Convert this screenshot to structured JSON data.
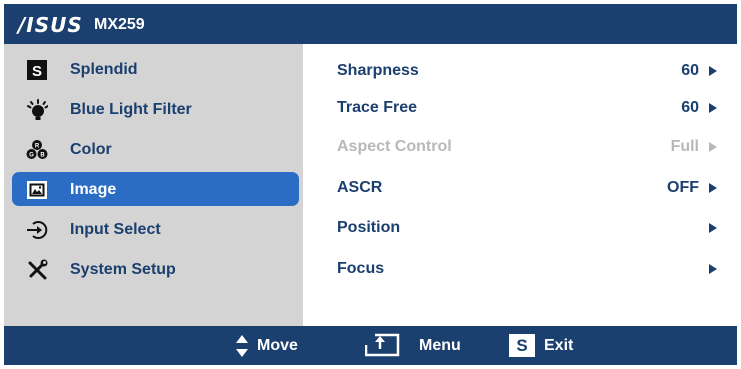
{
  "header": {
    "brand": "/ISUS",
    "model": "MX259"
  },
  "sidebar": {
    "items": [
      {
        "label": "Splendid"
      },
      {
        "label": "Blue Light Filter"
      },
      {
        "label": "Color"
      },
      {
        "label": "Image"
      },
      {
        "label": "Input Select"
      },
      {
        "label": "System Setup"
      }
    ]
  },
  "main": {
    "rows": [
      {
        "label": "Sharpness",
        "value": "60"
      },
      {
        "label": "Trace Free",
        "value": "60"
      },
      {
        "label": "Aspect Control",
        "value": "Full"
      },
      {
        "label": "ASCR",
        "value": "OFF"
      },
      {
        "label": "Position",
        "value": ""
      },
      {
        "label": "Focus",
        "value": ""
      }
    ]
  },
  "footer": {
    "move_label": "Move",
    "menu_label": "Menu",
    "exit_label": "Exit",
    "exit_key": "S"
  },
  "icons": {
    "splendid": "splendid-s-icon",
    "blue_light": "blue-light-filter-icon",
    "color": "color-rgb-icon",
    "image": "image-icon",
    "input": "input-select-icon",
    "system": "system-setup-tools-icon"
  },
  "colors": {
    "header_bg": "#1b3f6e",
    "sidebar_bg": "#d4d4d4",
    "selected_bg": "#2b6cc4",
    "disabled_text": "#b8b8b8"
  }
}
